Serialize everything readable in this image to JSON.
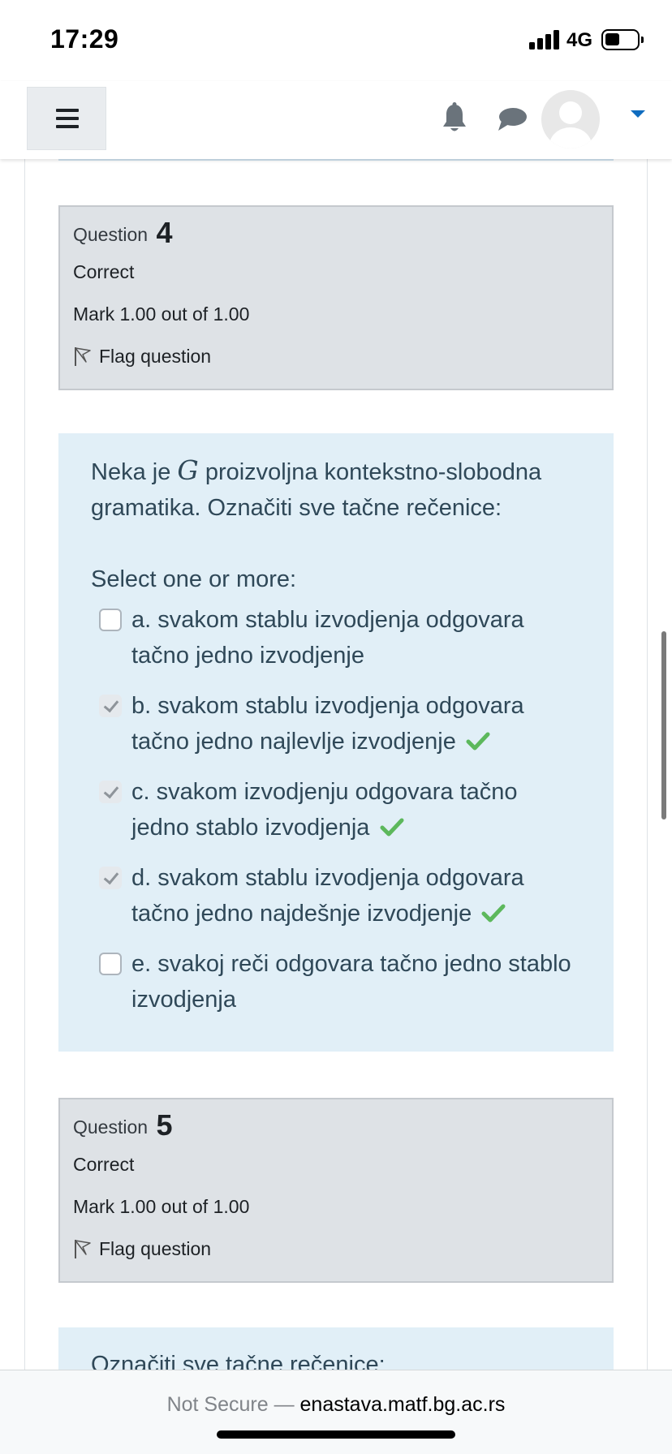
{
  "status_bar": {
    "time": "17:29",
    "network": "4G"
  },
  "navbar": {},
  "questions": [
    {
      "label": "Question",
      "number": "4",
      "state": "Correct",
      "grade": "Mark 1.00 out of 1.00",
      "flag_label": "Flag question",
      "text_before": "Neka je ",
      "math_symbol": "G",
      "text_after": " proizvoljna kontekstno-slobodna gramatika. Označiti sve tačne rečenice:",
      "prompt": "Select one or more:",
      "answers": [
        {
          "text": "a. svakom stablu izvodjenja odgovara tačno jedno izvodjenje",
          "checked": false,
          "correct": false
        },
        {
          "text": "b. svakom stablu izvodjenja odgovara tačno jedno najlevlje izvodjenje",
          "checked": true,
          "correct": true
        },
        {
          "text": "c. svakom izvodjenju odgovara tačno jedno stablo izvodjenja",
          "checked": true,
          "correct": true
        },
        {
          "text": "d. svakom stablu izvodjenja odgovara tačno jedno najdešnje izvodjenje",
          "checked": true,
          "correct": true
        },
        {
          "text": "e. svakoj reči odgovara tačno jedno stablo izvodjenja",
          "checked": false,
          "correct": false
        }
      ]
    },
    {
      "label": "Question",
      "number": "5",
      "state": "Correct",
      "grade": "Mark 1.00 out of 1.00",
      "flag_label": "Flag question",
      "text": "Označiti sve tačne rečenice:"
    }
  ],
  "browser": {
    "not_secure": "Not Secure — ",
    "host": "enastava.matf.bg.ac.rs"
  },
  "colors": {
    "accent": "#0f6cbf",
    "success": "#5cb85c",
    "formulation_bg": "#e1eff7",
    "info_bg": "#dee2e6"
  }
}
